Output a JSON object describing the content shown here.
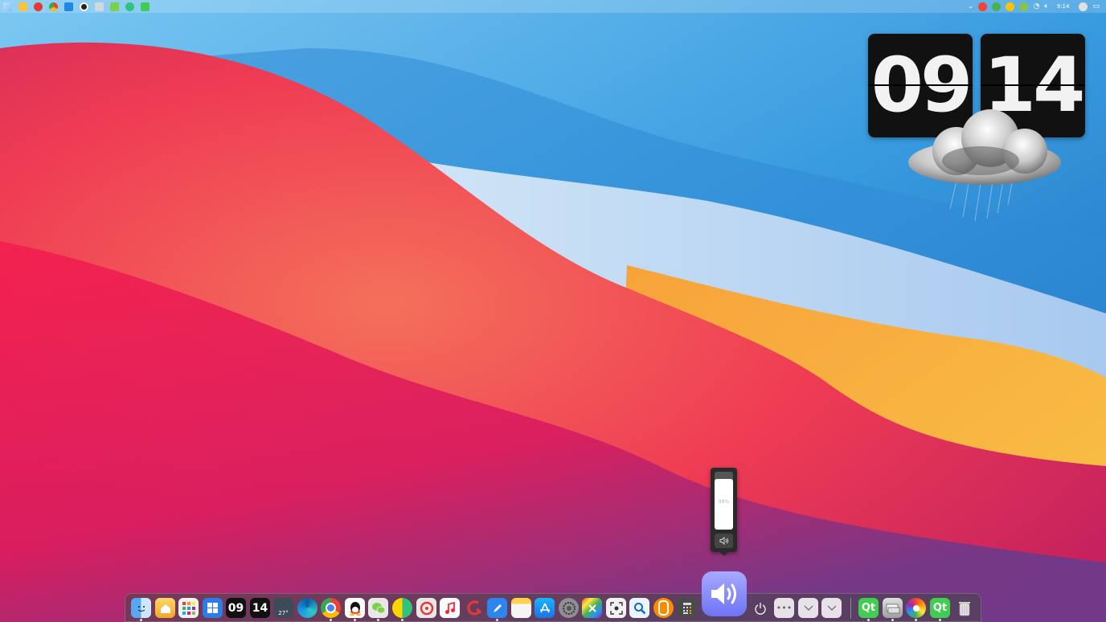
{
  "flip_clock": {
    "hours": "09",
    "minutes": "14",
    "weather_icon": "rain-cloud-icon"
  },
  "taskbar": {
    "time": "9:14",
    "left_icons": [
      "windows-start-icon",
      "file-explorer-icon",
      "netease-music-icon",
      "chrome-icon",
      "mail-icon",
      "obs-icon",
      "network-icon",
      "wechat-icon",
      "qq-music-icon",
      "qt-icon"
    ],
    "tray_icons": [
      "chevron-up-icon",
      "qq-icon",
      "wechat-icon",
      "tray-app-icon",
      "tray-app-icon-2",
      "wifi-icon",
      "speaker-icon"
    ],
    "notification_icon": "notification-icon"
  },
  "volume_popup": {
    "level": 0.88,
    "label": "88%",
    "mute_icon": "speaker-icon"
  },
  "dock": {
    "clock_hours": "09",
    "clock_minutes": "14",
    "weather_temp": "27°",
    "apps": [
      "finder-icon",
      "home-icon",
      "launchpad-icon",
      "windows-icon",
      "flip-clock-hours-icon",
      "flip-clock-minutes-icon",
      "weather-icon",
      "edge-icon",
      "chrome-icon",
      "qq-icon",
      "wechat-icon",
      "qq-music-icon",
      "netease-music-icon",
      "apple-music-icon",
      "red-app-icon",
      "pen-app-icon",
      "notes-icon",
      "app-store-icon",
      "settings-icon",
      "colors-icon",
      "screenshot-icon",
      "search-icon",
      "orange-app-icon",
      "calculator-icon",
      "volume-icon",
      "power-icon",
      "more-icon",
      "chevron-down-icon",
      "chevron-down-icon-2",
      "qt-creator-icon",
      "network-drive-icon",
      "colors-wheel-icon",
      "qt-icon",
      "trash-icon"
    ]
  },
  "colors": {
    "volume_accent": "#8a8df8",
    "dock_bg": "#464646"
  }
}
